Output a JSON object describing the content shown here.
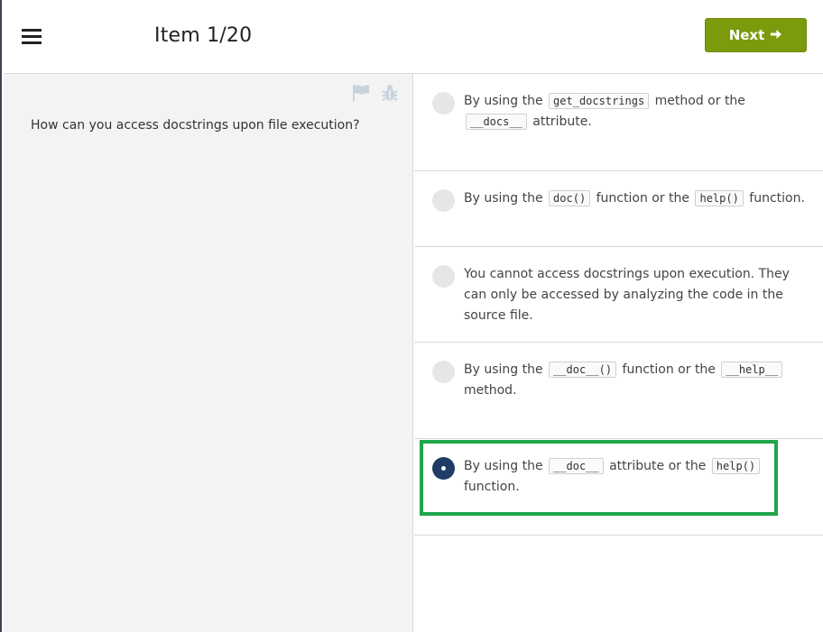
{
  "header": {
    "menu_icon": "hamburger-menu-icon",
    "item_counter": "Item 1/20",
    "next_label": "Next",
    "next_icon": "arrow-right-icon",
    "next_color": "#7b9b0c"
  },
  "question": {
    "text": "How can you access docstrings upon file execution?",
    "icons": [
      "flag-icon",
      "bug-icon"
    ]
  },
  "options": [
    {
      "parts": [
        "By using the",
        "get_docstrings",
        "method or the",
        "__docs__",
        "attribute."
      ],
      "selected": false
    },
    {
      "parts": [
        "By using the",
        "doc()",
        "function or the",
        "help()",
        "function."
      ],
      "selected": false
    },
    {
      "parts": [
        "You cannot access docstrings upon execution. They can only be accessed by analyzing the code in the source file."
      ],
      "selected": false
    },
    {
      "parts": [
        "By using the",
        "__doc__()",
        "function or the",
        "__help__",
        "method."
      ],
      "selected": false
    },
    {
      "parts": [
        "By using the",
        "__doc__",
        "attribute or the",
        "help()",
        "function."
      ],
      "selected": true
    }
  ],
  "colors": {
    "selected_radio": "#1f3b66",
    "highlight_border": "#1fa64a",
    "left_panel_bg": "#f3f3f3"
  }
}
